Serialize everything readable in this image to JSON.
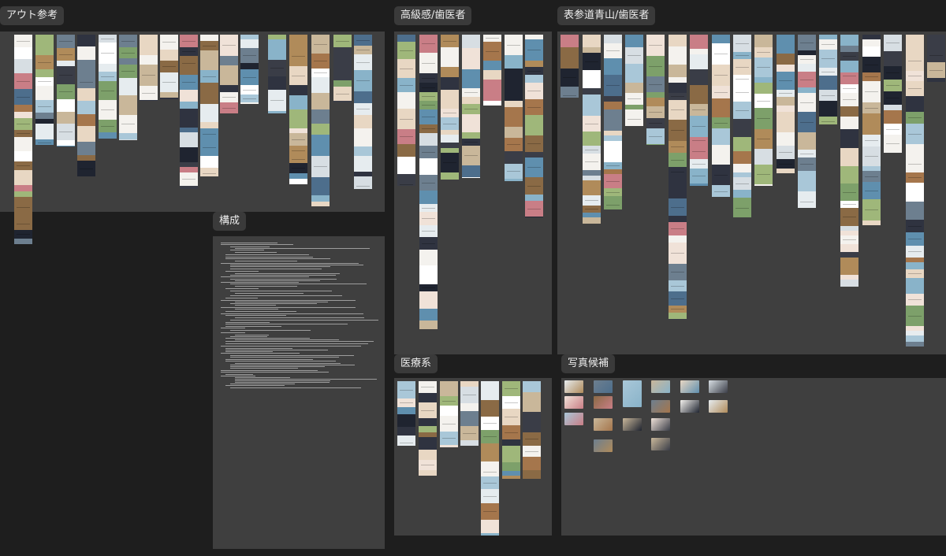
{
  "groups": {
    "layout_ref": {
      "label": "アウト参考"
    },
    "structure": {
      "label": "構成"
    },
    "luxury_dentist": {
      "label": "高級感/歯医者"
    },
    "omotesando_dentist": {
      "label": "表参道青山/歯医者"
    },
    "medical": {
      "label": "医療系"
    },
    "photo_candidates": {
      "label": "写真候補"
    }
  },
  "colors": {
    "canvas_bg": "#1e1e1e",
    "frame_bg": "#3f3f3f",
    "label_bg": "#3a3a3a",
    "label_text": "#ededed"
  }
}
